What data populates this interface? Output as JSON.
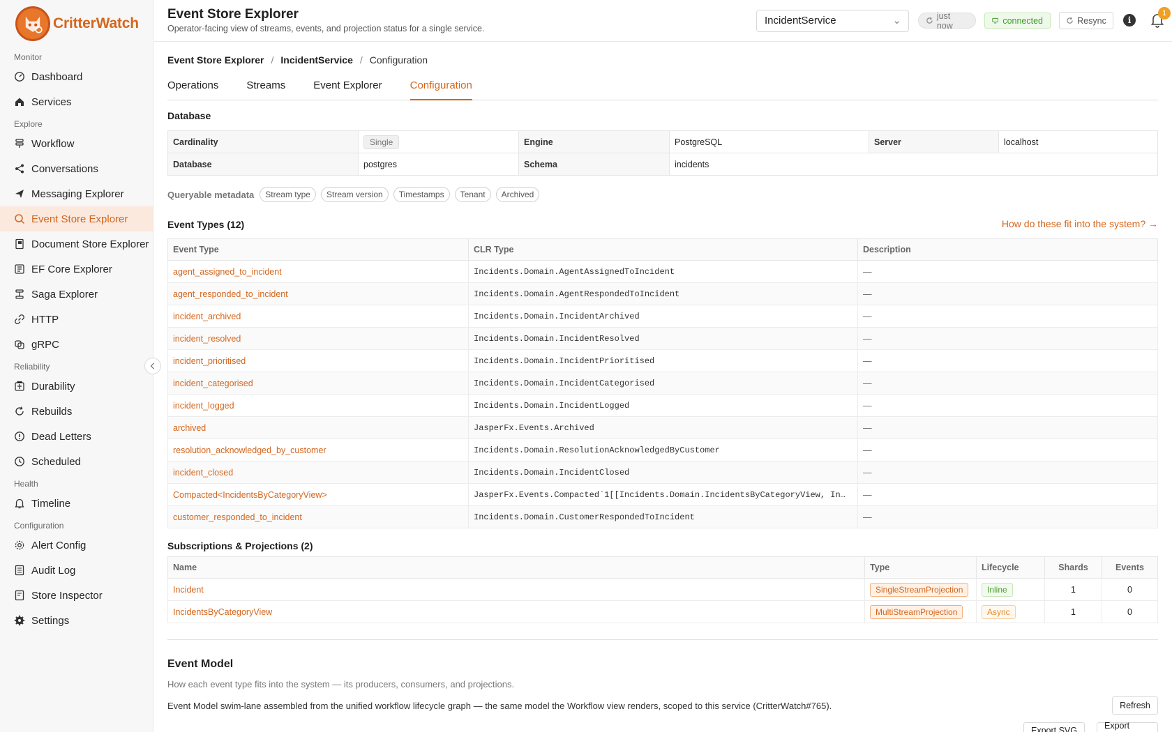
{
  "brand": {
    "name": "CritterWatch",
    "color": "#d4661d"
  },
  "sidebar": {
    "groups": [
      {
        "label": "Monitor",
        "items": [
          {
            "label": "Dashboard",
            "icon": "dashboard-icon"
          },
          {
            "label": "Services",
            "icon": "home-icon"
          }
        ]
      },
      {
        "label": "Explore",
        "items": [
          {
            "label": "Workflow",
            "icon": "workflow-icon"
          },
          {
            "label": "Conversations",
            "icon": "share-icon"
          },
          {
            "label": "Messaging Explorer",
            "icon": "send-icon"
          },
          {
            "label": "Event Store Explorer",
            "icon": "search-icon",
            "active": true
          },
          {
            "label": "Document Store Explorer",
            "icon": "document-icon"
          },
          {
            "label": "EF Core Explorer",
            "icon": "ef-icon"
          },
          {
            "label": "Saga Explorer",
            "icon": "saga-icon"
          },
          {
            "label": "HTTP",
            "icon": "link-icon"
          },
          {
            "label": "gRPC",
            "icon": "grpc-icon"
          }
        ]
      },
      {
        "label": "Reliability",
        "items": [
          {
            "label": "Durability",
            "icon": "durability-icon"
          },
          {
            "label": "Rebuilds",
            "icon": "refresh-icon"
          },
          {
            "label": "Dead Letters",
            "icon": "alert-icon"
          },
          {
            "label": "Scheduled",
            "icon": "clock-icon"
          }
        ]
      },
      {
        "label": "Health",
        "items": [
          {
            "label": "Timeline",
            "icon": "bell-icon"
          }
        ]
      },
      {
        "label": "Configuration",
        "items": [
          {
            "label": "Alert Config",
            "icon": "gear-icon"
          },
          {
            "label": "Audit Log",
            "icon": "log-icon"
          },
          {
            "label": "Store Inspector",
            "icon": "inspector-icon"
          },
          {
            "label": "Settings",
            "icon": "settings-icon"
          }
        ]
      }
    ]
  },
  "header": {
    "title": "Event Store Explorer",
    "subtitle": "Operator-facing view of streams, events, and projection status for a single service.",
    "service": "IncidentService",
    "updated": "just now",
    "status": "connected",
    "resync": "Resync",
    "info": "i",
    "notifications": "1"
  },
  "breadcrumb": {
    "root": "Event Store Explorer",
    "service": "IncidentService",
    "current": "Configuration",
    "sep": "/"
  },
  "tabs": [
    {
      "label": "Operations"
    },
    {
      "label": "Streams"
    },
    {
      "label": "Event Explorer"
    },
    {
      "label": "Configuration",
      "active": true
    }
  ],
  "database": {
    "title": "Database",
    "cardinality_label": "Cardinality",
    "cardinality": "Single",
    "engine_label": "Engine",
    "engine": "PostgreSQL",
    "server_label": "Server",
    "server": "localhost",
    "database_label": "Database",
    "database": "postgres",
    "schema_label": "Schema",
    "schema": "incidents"
  },
  "metadata": {
    "label": "Queryable metadata",
    "chips": [
      "Stream type",
      "Stream version",
      "Timestamps",
      "Tenant",
      "Archived"
    ]
  },
  "event_types": {
    "title": "Event Types (12)",
    "link": "How do these fit into the system? →",
    "headers": [
      "Event Type",
      "CLR Type",
      "Description"
    ],
    "rows": [
      {
        "name": "agent_assigned_to_incident",
        "clr": "Incidents.Domain.AgentAssignedToIncident",
        "desc": "—"
      },
      {
        "name": "agent_responded_to_incident",
        "clr": "Incidents.Domain.AgentRespondedToIncident",
        "desc": "—"
      },
      {
        "name": "incident_archived",
        "clr": "Incidents.Domain.IncidentArchived",
        "desc": "—"
      },
      {
        "name": "incident_resolved",
        "clr": "Incidents.Domain.IncidentResolved",
        "desc": "—"
      },
      {
        "name": "incident_prioritised",
        "clr": "Incidents.Domain.IncidentPrioritised",
        "desc": "—"
      },
      {
        "name": "incident_categorised",
        "clr": "Incidents.Domain.IncidentCategorised",
        "desc": "—"
      },
      {
        "name": "incident_logged",
        "clr": "Incidents.Domain.IncidentLogged",
        "desc": "—"
      },
      {
        "name": "archived",
        "clr": "JasperFx.Events.Archived",
        "desc": "—"
      },
      {
        "name": "resolution_acknowledged_by_customer",
        "clr": "Incidents.Domain.ResolutionAcknowledgedByCustomer",
        "desc": "—"
      },
      {
        "name": "incident_closed",
        "clr": "Incidents.Domain.IncidentClosed",
        "desc": "—"
      },
      {
        "name": "Compacted<IncidentsByCategoryView>",
        "clr": "JasperFx.Events.Compacted`1[[Incidents.Domain.IncidentsByCategoryView, In…",
        "desc": "—"
      },
      {
        "name": "customer_responded_to_incident",
        "clr": "Incidents.Domain.CustomerRespondedToIncident",
        "desc": "—"
      }
    ]
  },
  "subscriptions": {
    "title": "Subscriptions & Projections (2)",
    "headers": [
      "Name",
      "Type",
      "Lifecycle",
      "Shards",
      "Events"
    ],
    "rows": [
      {
        "name": "Incident",
        "type": "SingleStreamProjection",
        "lifecycle": "Inline",
        "shards": "1",
        "events": "0"
      },
      {
        "name": "IncidentsByCategoryView",
        "type": "MultiStreamProjection",
        "lifecycle": "Async",
        "shards": "1",
        "events": "0"
      }
    ]
  },
  "event_model": {
    "title": "Event Model",
    "subtitle": "How each event type fits into the system — its producers, consumers, and projections.",
    "description": "Event Model swim-lane assembled from the unified workflow lifecycle graph — the same model the Workflow view renders, scoped to this service (CritterWatch#765).",
    "refresh": "Refresh",
    "export_svg": "Export SVG",
    "export_png": "Export PNG"
  }
}
